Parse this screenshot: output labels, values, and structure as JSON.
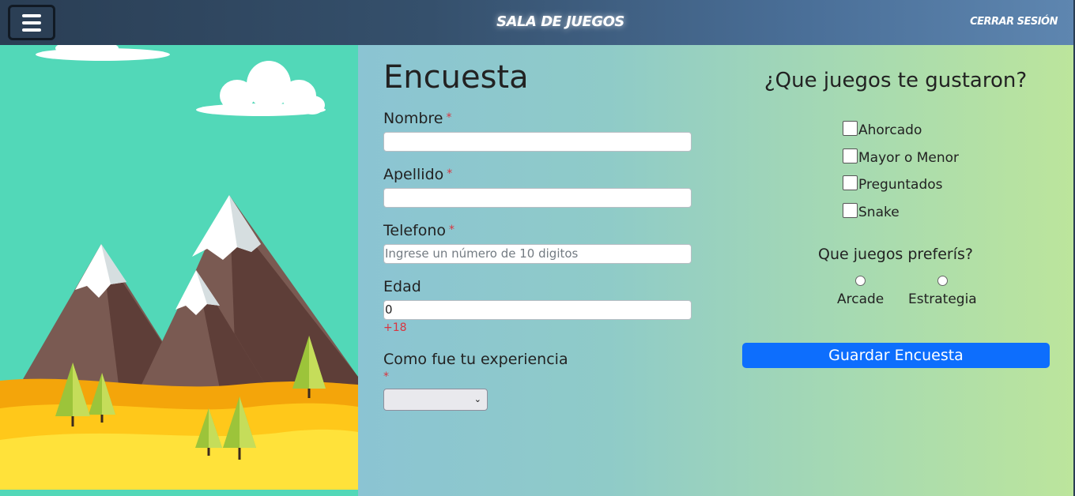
{
  "nav": {
    "brand": "SALA DE JUEGOS",
    "logout": "CERRAR SESIÓN"
  },
  "form": {
    "title": "Encuesta",
    "required_mark": "*",
    "fields": [
      {
        "label": "Nombre",
        "value": ""
      },
      {
        "label": "Apellido",
        "value": ""
      },
      {
        "label": "Telefono",
        "placeholder": "Ingrese un número de 10 digitos"
      },
      {
        "label": "Edad",
        "value": "0",
        "hint": "+18"
      },
      {
        "label": "Como fue tu experiencia",
        "value": ""
      }
    ]
  },
  "survey": {
    "games_question": "¿Que juegos te gustaron?",
    "games": [
      "Ahorcado",
      "Mayor o Menor",
      "Preguntados",
      "Snake"
    ],
    "preference_question": "Que juegos preferís?",
    "preferences": [
      "Arcade",
      "Estrategia"
    ],
    "save_label": "Guardar Encuesta"
  },
  "colors": {
    "primary_button": "#0d6efd",
    "required": "#d9343f",
    "navbar": "#35506c"
  },
  "icons": [
    "hamburger-menu-icon",
    "chevron-down-icon"
  ]
}
